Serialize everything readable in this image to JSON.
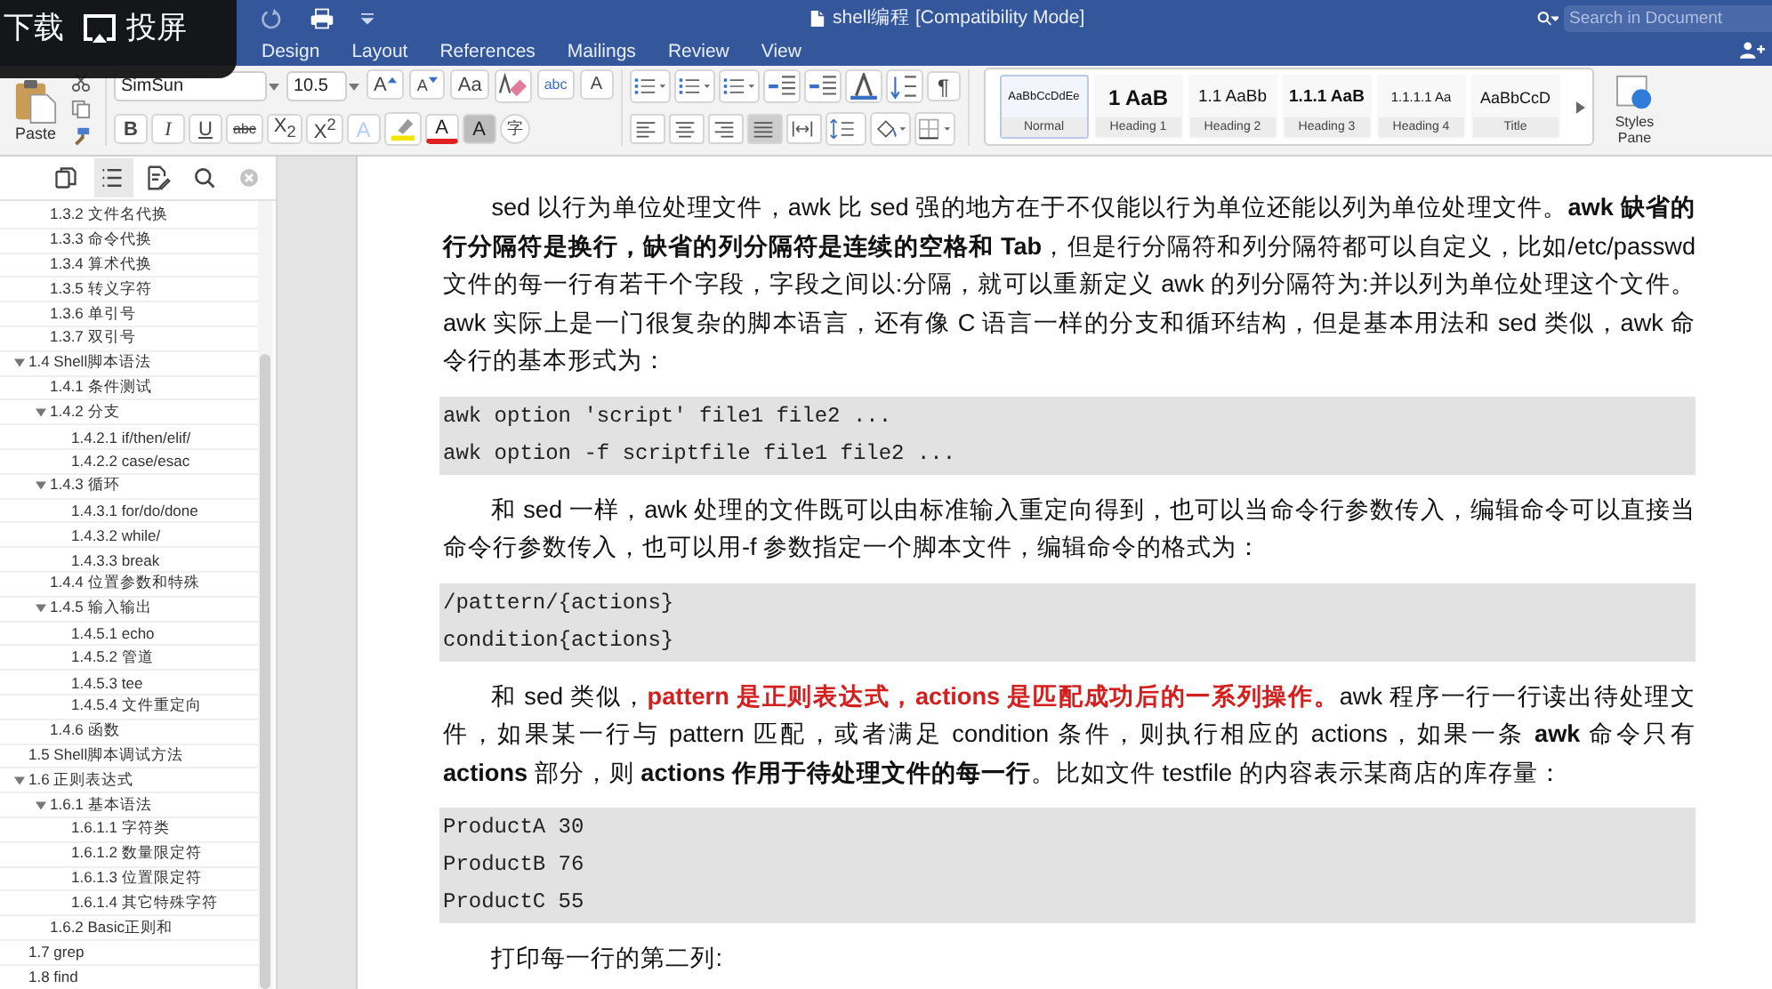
{
  "overlay": {
    "buttons": [
      {
        "label": "下载",
        "kind": "download"
      },
      {
        "label": "投屏",
        "kind": "cast"
      }
    ]
  },
  "titlebar": {
    "title": "shell编程 [Compatibility Mode]",
    "search": {
      "placeholder": "Search in Document"
    }
  },
  "tabs": [
    {
      "label": "Design",
      "selected": false
    },
    {
      "label": "Layout",
      "selected": false
    },
    {
      "label": "References",
      "selected": false
    },
    {
      "label": "Mailings",
      "selected": false
    },
    {
      "label": "Review",
      "selected": false
    },
    {
      "label": "View",
      "selected": false
    }
  ],
  "clipboard": {
    "paste": "Paste"
  },
  "font": {
    "name": "SimSun",
    "size": "10.5",
    "row1": [
      {
        "label": "A",
        "kind": "grow"
      },
      {
        "label": "A",
        "kind": "shrink"
      },
      {
        "label": "Aa",
        "kind": "case"
      },
      {
        "kind": "clear"
      },
      {
        "label": "abc",
        "kind": "phonetic"
      },
      {
        "label": "A",
        "kind": "border"
      }
    ],
    "row2": [
      {
        "label": "B",
        "kind": "bold"
      },
      {
        "label": "I",
        "kind": "italic"
      },
      {
        "label": "U",
        "kind": "underline"
      },
      {
        "label": "abc",
        "kind": "strike"
      },
      {
        "label": "X$_{2}$",
        "kind": "sub"
      },
      {
        "label": "X$^{2}$",
        "kind": "sup"
      },
      {
        "label": "A",
        "kind": "effects"
      },
      {
        "kind": "highlight"
      },
      {
        "label": "A",
        "kind": "color"
      },
      {
        "label": "A",
        "kind": "shade"
      },
      {
        "label": "字",
        "kind": "enclose"
      }
    ]
  },
  "paragraph": {
    "row1": [
      {
        "kind": "bullets"
      },
      {
        "kind": "numbering"
      },
      {
        "kind": "multilevel"
      },
      {
        "kind": "outdent"
      },
      {
        "kind": "indent"
      },
      {
        "kind": "asian"
      },
      {
        "kind": "sort"
      },
      {
        "label": "¶",
        "kind": "marks"
      }
    ],
    "align": [
      {
        "kind": "left",
        "selected": false
      },
      {
        "kind": "center",
        "selected": false
      },
      {
        "kind": "right",
        "selected": false
      },
      {
        "kind": "justify",
        "selected": true
      },
      {
        "kind": "distribute",
        "selected": false
      }
    ],
    "row2": [
      {
        "kind": "spacing"
      },
      {
        "kind": "shading"
      },
      {
        "kind": "borders"
      }
    ]
  },
  "styles": [
    {
      "preview": "AaBbCcDdEe",
      "name": "Normal",
      "kind": "normal",
      "selected": true
    },
    {
      "preview": "1 AaB",
      "name": "Heading 1",
      "kind": "h1",
      "selected": false
    },
    {
      "preview": "1.1 AaBb",
      "name": "Heading 2",
      "kind": "h2",
      "selected": false
    },
    {
      "preview": "1.1.1 AaB",
      "name": "Heading 3",
      "kind": "h3",
      "selected": false
    },
    {
      "preview": "1.1.1.1 Aa",
      "name": "Heading 4",
      "kind": "h4",
      "selected": false
    },
    {
      "preview": "AaBbCcD",
      "name": "Title",
      "kind": "title",
      "selected": false
    }
  ],
  "styles_pane": "Styles Pane",
  "sidebar": {
    "tabs": [
      {
        "kind": "thumbnails",
        "selected": false
      },
      {
        "kind": "outline",
        "selected": true
      },
      {
        "kind": "changes",
        "selected": false
      },
      {
        "kind": "search",
        "selected": false
      }
    ],
    "outline": [
      {
        "children": [
          {
            "label": "1.3.2 文件名代换"
          },
          {
            "label": "1.3.3 命令代换"
          },
          {
            "label": "1.3.4 算术代换"
          },
          {
            "label": "1.3.5 转义字符"
          },
          {
            "label": "1.3.6 单引号"
          },
          {
            "label": "1.3.7 双引号"
          }
        ]
      },
      {
        "label": "1.4 Shell脚本语法",
        "expanded": true,
        "children": [
          {
            "label": "1.4.1 条件测试"
          },
          {
            "label": "1.4.2 分支",
            "expanded": true,
            "children": [
              {
                "label": "1.4.2.1 if/then/elif/"
              },
              {
                "label": "1.4.2.2 case/esac"
              }
            ]
          },
          {
            "label": "1.4.3 循环",
            "expanded": true,
            "children": [
              {
                "label": "1.4.3.1 for/do/done"
              },
              {
                "label": "1.4.3.2 while/"
              },
              {
                "label": "1.4.3.3 break"
              }
            ]
          },
          {
            "label": "1.4.4 位置参数和特殊"
          },
          {
            "label": "1.4.5 输入输出",
            "expanded": true,
            "children": [
              {
                "label": "1.4.5.1 echo"
              },
              {
                "label": "1.4.5.2 管道"
              },
              {
                "label": "1.4.5.3 tee"
              },
              {
                "label": "1.4.5.4 文件重定向"
              }
            ]
          },
          {
            "label": "1.4.6 函数"
          }
        ]
      },
      {
        "label": "1.5 Shell脚本调试方法"
      },
      {
        "label": "1.6 正则表达式",
        "expanded": true,
        "children": [
          {
            "label": "1.6.1 基本语法",
            "expanded": true,
            "children": [
              {
                "label": "1.6.1.1 字符类"
              },
              {
                "label": "1.6.1.2 数量限定符"
              },
              {
                "label": "1.6.1.3 位置限定符"
              },
              {
                "label": "1.6.1.4 其它特殊字符"
              }
            ]
          },
          {
            "label": "1.6.2 Basic正则和"
          }
        ]
      },
      {
        "label": "1.7 grep"
      },
      {
        "label": "1.8 find"
      }
    ]
  },
  "document": [
    {
      "kind": "para",
      "segments": [
        {
          "kind": "plain",
          "text": "sed 以行为单位处理文件，awk 比 sed 强的地方在于不仅能以行为单位还能以列为单位处理文件。"
        },
        {
          "kind": "bold",
          "text": "awk 缺省的行分隔符是换行，缺省的列分隔符是连续的空格和 Tab"
        },
        {
          "kind": "plain",
          "text": "，但是行分隔符和列分隔符都可以自定义，比如/etc/passwd 文件的每一行有若干个字段，字段之间以:分隔，就可以重新定义 awk 的列分隔符为:并以列为单位处理这个文件。awk 实际上是一门很复杂的脚本语言，还有像 C 语言一样的分支和循环结构，但是基本用法和 sed 类似，awk 命令行的基本形式为："
        }
      ]
    },
    {
      "kind": "code",
      "lines": [
        "awk option 'script' file1 file2 ...",
        "awk option -f scriptfile file1 file2 ..."
      ]
    },
    {
      "kind": "para",
      "segments": [
        {
          "kind": "plain",
          "text": "和 sed 一样，awk 处理的文件既可以由标准输入重定向得到，也可以当命令行参数传入，编辑命令可以直接当命令行参数传入，也可以用-f 参数指定一个脚本文件，编辑命令的格式为："
        }
      ]
    },
    {
      "kind": "code",
      "lines": [
        "/pattern/{actions}",
        "condition{actions}"
      ]
    },
    {
      "kind": "para",
      "segments": [
        {
          "kind": "plain",
          "text": "和 sed 类似，"
        },
        {
          "kind": "highlight",
          "text": "pattern 是正则表达式，actions 是匹配成功后的一系列操作。"
        },
        {
          "kind": "plain",
          "text": "awk 程序一行一行读出待处理文件，如果某一行与 pattern 匹配，或者满足 condition 条件，则执行相应的 actions，如果一条 "
        },
        {
          "kind": "bold",
          "text": "awk"
        },
        {
          "kind": "plain",
          "text": " 命令只有 "
        },
        {
          "kind": "bold",
          "text": "actions"
        },
        {
          "kind": "plain",
          "text": " 部分，则 "
        },
        {
          "kind": "bold",
          "text": "actions 作用于待处理文件的每一行"
        },
        {
          "kind": "plain",
          "text": "。比如文件 testfile 的内容表示某商店的库存量："
        }
      ]
    },
    {
      "kind": "code",
      "lines": [
        "ProductA 30",
        "ProductB 76",
        "ProductC 55"
      ]
    },
    {
      "kind": "para",
      "segments": [
        {
          "kind": "plain",
          "text": "打印每一行的第二列:"
        }
      ]
    }
  ]
}
